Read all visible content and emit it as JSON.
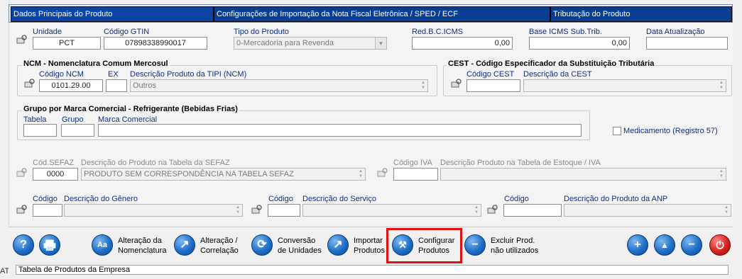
{
  "tabs": [
    {
      "label": "Dados Principais do Produto",
      "active": true
    },
    {
      "label": "Configurações de Importação da Nota Fiscal Eletrônica / SPED / ECF",
      "active": false
    },
    {
      "label": "Tributação do Produto",
      "active": false
    }
  ],
  "main": {
    "unidade": {
      "label": "Unidade",
      "value": "PCT"
    },
    "gtin": {
      "label": "Código GTIN",
      "value": "07898338990017"
    },
    "tipo": {
      "label": "Tipo do Produto",
      "value": "0-Mercadoria para Revenda"
    },
    "red_bc": {
      "label": "Red.B.C.ICMS",
      "value": "0,00"
    },
    "base_icms": {
      "label": "Base ICMS Sub.Trib.",
      "value": "0,00"
    },
    "data_atual": {
      "label": "Data Atualização",
      "value": ""
    }
  },
  "ncm": {
    "title": "NCM - Nomenclatura Comum Mercosul",
    "codigo_label": "Código NCM",
    "codigo_value": "0101.29.00",
    "ex_label": "EX",
    "ex_value": "",
    "desc_label": "Descrição Produto da TIPI (NCM)",
    "desc_value": "Outros"
  },
  "cest": {
    "title": "CEST - Código Especificador da Substituição Tributária",
    "codigo_label": "Código CEST",
    "codigo_value": "",
    "desc_label": "Descrição da CEST",
    "desc_value": ""
  },
  "marca": {
    "title": "Grupo por Marca Comercial - Refrigerante (Bebidas Frias)",
    "tabela_label": "Tabela",
    "grupo_label": "Grupo",
    "marca_label": "Marca Comercial",
    "tabela_value": "",
    "grupo_value": "",
    "marca_value": ""
  },
  "medicamento": {
    "label": "Medicamento  (Registro  57)",
    "checked": false
  },
  "sefaz": {
    "codigo_label": "Cód.SEFAZ",
    "codigo_value": "0000",
    "desc_label": "Descrição do Produto na Tabela da SEFAZ",
    "desc_value": "PRODUTO SEM CORRESPONDÊNCIA NA TABELA SEFAZ"
  },
  "iva": {
    "codigo_label": "Código IVA",
    "codigo_value": "",
    "desc_label": "Descrição Produto na Tabela de Estoque / IVA",
    "desc_value": ""
  },
  "genero": {
    "codigo_label": "Código",
    "codigo_value": "",
    "desc_label": "Descrição do Gênero",
    "desc_value": ""
  },
  "servico": {
    "codigo_label": "Código",
    "codigo_value": "",
    "desc_label": "Descrição do Serviço",
    "desc_value": ""
  },
  "anp": {
    "codigo_label": "Código",
    "codigo_value": "",
    "desc_label": "Descrição do Produto da ANP",
    "desc_value": ""
  },
  "toolbar": {
    "help_icon": "?",
    "alteracao_nomenclatura": {
      "line1": "Alteração da",
      "line2": "Nomenclatura",
      "icon": "Aa"
    },
    "alteracao_correlacao": {
      "line1": "Alteração /",
      "line2": "Correlação"
    },
    "conversao": {
      "line1": "Conversão",
      "line2": "de Unidades"
    },
    "importar": {
      "line1": "Importar",
      "line2": "Produtos"
    },
    "configurar": {
      "line1": "Configurar",
      "line2": "Produtos"
    },
    "excluir": {
      "line1": "Excluir Prod.",
      "line2": "não utilizados"
    },
    "add_icon": "+",
    "up_icon": "▲",
    "remove_icon": "−"
  },
  "status": {
    "text": "Tabela de Produtos da Empresa",
    "left_stub": "AT"
  },
  "colors": {
    "tab_bg": "#0a3e93",
    "label": "#0e2e82",
    "highlight": "#e01010",
    "button": "#1f6fc8",
    "exit": "#d92020"
  }
}
